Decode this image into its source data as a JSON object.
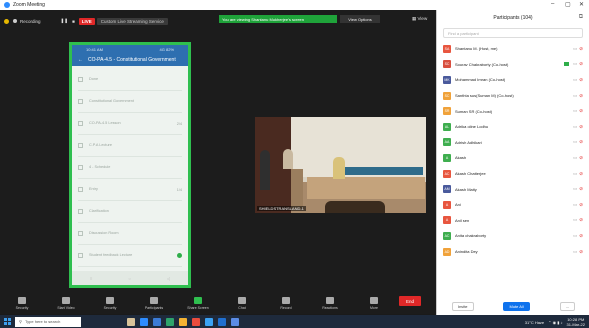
{
  "window": {
    "title": "Zoom Meeting",
    "controls": [
      "–",
      "▢",
      "✕"
    ]
  },
  "topbar": {
    "recording": "Recording",
    "live_badge": "LIVE",
    "viewing": "Custom Live Streaming Service",
    "banner": "You are viewing Shantanu Mukherjee's screen",
    "stop_button": "View Options",
    "view_button": "View"
  },
  "phone": {
    "status_left": "10:41 AM",
    "status_right": "4G 82%",
    "header_title": "CO-PA-4.5 - Constitutional Government",
    "rows": [
      {
        "text": "Done",
        "right": "",
        "check": false
      },
      {
        "text": "Constitutional Government",
        "right": "",
        "check": false
      },
      {
        "text": "CO-PA-4.5 Lesson",
        "right": "2/4",
        "check": false
      },
      {
        "text": "C.P.A Lecture",
        "right": "",
        "check": false
      },
      {
        "text": "4 - Schedule",
        "right": "",
        "check": false
      },
      {
        "text": "Entry",
        "right": "1/4",
        "check": false
      },
      {
        "text": "Clarification",
        "right": "",
        "check": false
      },
      {
        "text": "Discussion Room",
        "right": "",
        "check": false
      },
      {
        "text": "Student feedback Lecture",
        "right": "",
        "check": true
      }
    ]
  },
  "video": {
    "label": "SHIELDSTRANSLAND-1"
  },
  "toolbar": {
    "items": [
      "Security",
      "Start Video",
      "Security",
      "Participants",
      "Share Screen",
      "Chat",
      "Record",
      "Reactions",
      "More"
    ],
    "participants_count": "108",
    "end_label": "End"
  },
  "participants": {
    "title": "Participants (104)",
    "search_placeholder": "Find a participant",
    "list": [
      {
        "initials": "SA",
        "color": "#e8563f",
        "name": "Shantanu M. (Host, me)",
        "extra": false
      },
      {
        "initials": "SC",
        "color": "#d94f3f",
        "name": "Sourav Chakraborty (Co-host)",
        "extra": true
      },
      {
        "initials": "MK",
        "color": "#4a5a9c",
        "name": "Mohammad Imran (Co-host)",
        "extra": false
      },
      {
        "initials": "SC",
        "color": "#f0a23a",
        "name": "Santhta sus(Suman M) (Co-host)",
        "extra": false
      },
      {
        "initials": "SR",
        "color": "#f0a23a",
        "name": "Suman SR (Co-host)",
        "extra": false
      },
      {
        "initials": "AL",
        "color": "#3fae4f",
        "name": "Adrika oline Lodhu",
        "extra": false
      },
      {
        "initials": "AA",
        "color": "#3fae4f",
        "name": "Adrish Adhikari",
        "extra": false
      },
      {
        "initials": "A",
        "color": "#3fae4f",
        "name": "Akash",
        "extra": false
      },
      {
        "initials": "AC",
        "color": "#e8563f",
        "name": "Akash Chatterjee",
        "extra": false
      },
      {
        "initials": "AM",
        "color": "#4a5a9c",
        "name": "Akash Maity",
        "extra": false
      },
      {
        "initials": "A",
        "color": "#e8563f",
        "name": "Ani",
        "extra": false
      },
      {
        "initials": "A",
        "color": "#e8563f",
        "name": "Anil sen",
        "extra": false
      },
      {
        "initials": "AC",
        "color": "#3fae4f",
        "name": "Anita chakraborty",
        "extra": false
      },
      {
        "initials": "AD",
        "color": "#f0a23a",
        "name": "Anindita Dey",
        "extra": false
      }
    ],
    "invite_label": "Invite",
    "mute_all_label": "Mute All",
    "more_label": "..."
  },
  "taskbar": {
    "search_placeholder": "Type here to search",
    "weather": "31°C Haze",
    "time": "10:28 PM",
    "date": "31-Mar-22"
  }
}
